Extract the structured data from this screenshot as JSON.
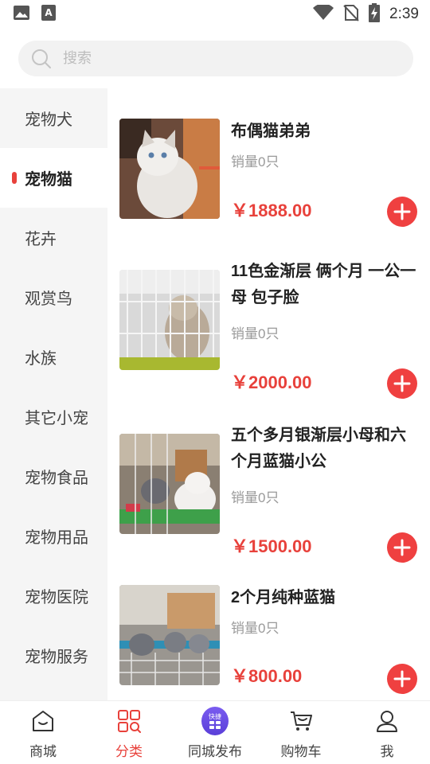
{
  "status_bar": {
    "time": "2:39",
    "left_icons": [
      "image-icon",
      "font-icon"
    ],
    "right_icons": [
      "wifi-icon",
      "no-sim-icon",
      "battery-charging-icon"
    ]
  },
  "search": {
    "placeholder": "搜索",
    "value": ""
  },
  "sidebar": {
    "items": [
      {
        "label": "宠物犬"
      },
      {
        "label": "宠物猫",
        "active": true
      },
      {
        "label": "花卉"
      },
      {
        "label": "观赏鸟"
      },
      {
        "label": "水族"
      },
      {
        "label": "其它小宠"
      },
      {
        "label": "宠物食品"
      },
      {
        "label": "宠物用品"
      },
      {
        "label": "宠物医院"
      },
      {
        "label": "宠物服务"
      }
    ]
  },
  "products": [
    {
      "title": "布偶猫弟弟",
      "sales": "销量0只",
      "price": "￥1888.00"
    },
    {
      "title": "11色金渐层 俩个月 一公一母 包子脸",
      "sales": "销量0只",
      "price": "￥2000.00"
    },
    {
      "title": "五个多月银渐层小母和六个月蓝猫小公",
      "sales": "销量0只",
      "price": "￥1500.00"
    },
    {
      "title": "2个月纯种蓝猫",
      "sales": "销量0只",
      "price": "￥800.00"
    }
  ],
  "tabs": [
    {
      "label": "商城",
      "icon": "shop-icon"
    },
    {
      "label": "分类",
      "icon": "category-icon",
      "active": true
    },
    {
      "label": "同城发布",
      "icon": "publish-icon",
      "badge": "快捷"
    },
    {
      "label": "购物车",
      "icon": "cart-icon"
    },
    {
      "label": "我",
      "icon": "profile-icon"
    }
  ],
  "colors": {
    "accent": "#e8413b",
    "sidebar_bg": "#f5f5f5",
    "publish_purple": "#6a4ce6"
  }
}
